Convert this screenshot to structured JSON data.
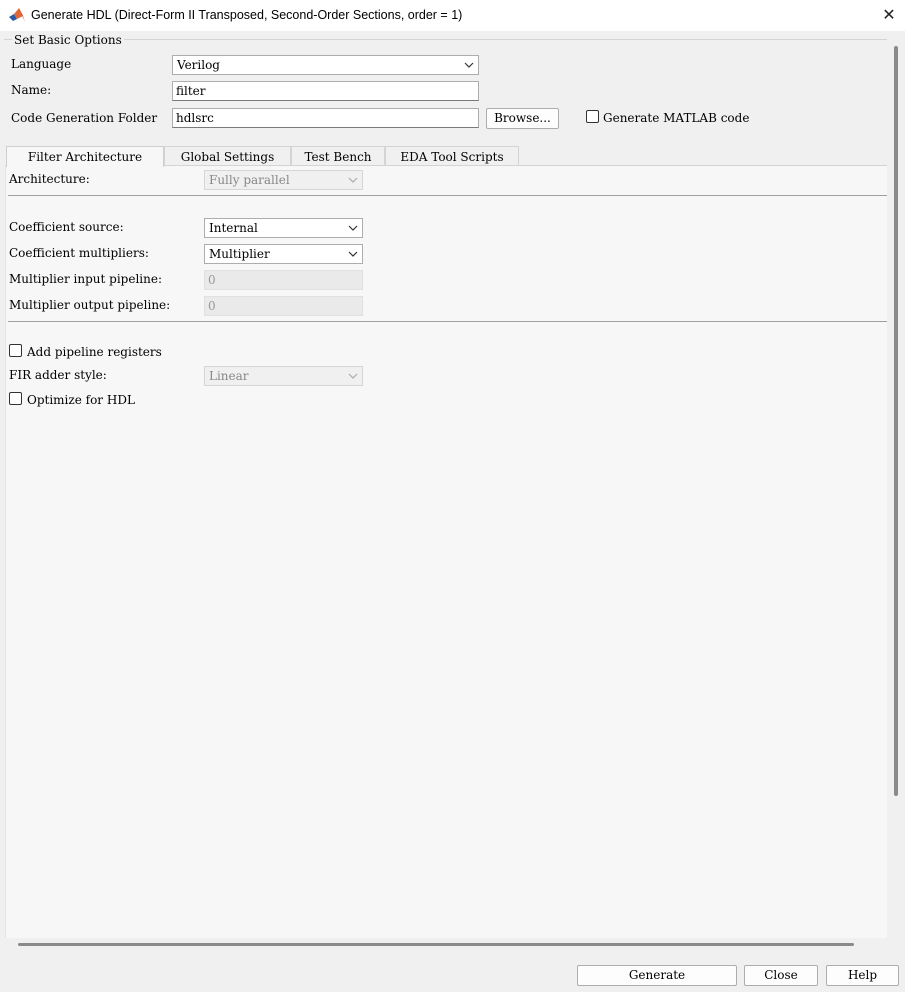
{
  "window": {
    "title": "Generate HDL (Direct-Form II Transposed, Second-Order Sections, order = 1)",
    "icon": "matlab-logo-icon",
    "close_glyph": "✕"
  },
  "basic_options": {
    "group_label": "Set Basic Options",
    "language_label": "Language",
    "language_value": "Verilog",
    "name_label": "Name:",
    "name_value": "filter",
    "folder_label": "Code Generation Folder",
    "folder_value": "hdlsrc",
    "browse_label": "Browse...",
    "matlab_code_label": "Generate MATLAB code",
    "matlab_code_checked": false
  },
  "tabs": [
    {
      "label": "Filter Architecture",
      "active": true
    },
    {
      "label": "Global Settings",
      "active": false
    },
    {
      "label": "Test Bench",
      "active": false
    },
    {
      "label": "EDA Tool Scripts",
      "active": false
    }
  ],
  "filter_architecture": {
    "architecture_label": "Architecture:",
    "architecture_value": "Fully parallel",
    "coeff_source_label": "Coefficient source:",
    "coeff_source_value": "Internal",
    "coeff_mult_label": "Coefficient multipliers:",
    "coeff_mult_value": "Multiplier",
    "mult_in_pipe_label": "Multiplier input pipeline:",
    "mult_in_pipe_value": "0",
    "mult_out_pipe_label": "Multiplier output pipeline:",
    "mult_out_pipe_value": "0",
    "add_pipeline_label": "Add pipeline registers",
    "add_pipeline_checked": false,
    "fir_adder_label": "FIR adder style:",
    "fir_adder_value": "Linear",
    "optimize_label": "Optimize for HDL",
    "optimize_checked": false
  },
  "footer": {
    "generate_label": "Generate",
    "close_label": "Close",
    "help_label": "Help"
  },
  "icons": {
    "dropdown": "chevron-down-icon"
  },
  "colors": {
    "background": "#f0f0f0",
    "panel": "#f7f7f7",
    "titlebar": "#ffffff",
    "logo_orange": "#e16737",
    "logo_red": "#b62f1c",
    "logo_blue": "#2a5aa8"
  }
}
